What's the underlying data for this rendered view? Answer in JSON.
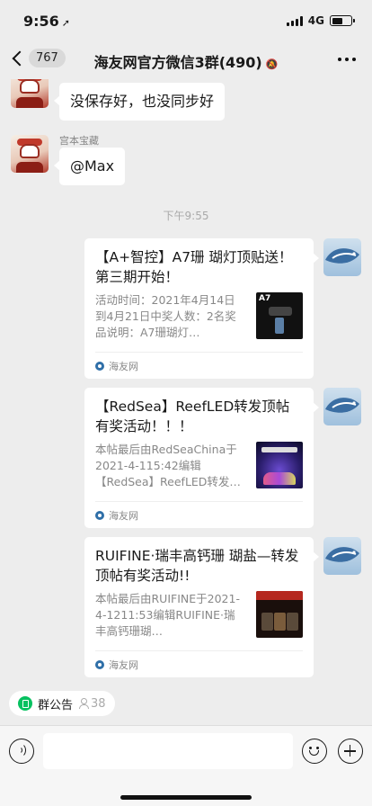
{
  "status_bar": {
    "time": "9:56",
    "network": "4G"
  },
  "nav": {
    "back_badge": "767",
    "title": "海友网官方微信3群(490)"
  },
  "messages": [
    {
      "text": "没保存好，也没同步好"
    },
    {
      "sender": "宫本宝藏",
      "text": "@Max"
    }
  ],
  "time_separator": "下午9:55",
  "cards": [
    {
      "title": "【A+智控】A7珊 瑚灯顶贴送！第三期开始！",
      "desc": "活动时间：2021年4月14日到4月21日中奖人数：2名奖品说明：A7珊瑚灯…",
      "thumb_label": "A7",
      "source": "海友网"
    },
    {
      "title": "【RedSea】ReefLED转发顶帖有奖活动！！！",
      "desc": "本帖最后由RedSeaChina于2021-4-115:42编辑【RedSea】ReefLED转发…",
      "source": "海友网"
    },
    {
      "title": "RUIFINE·瑞丰高钙珊 瑚盐—转发顶帖有奖活动!!",
      "desc": "本帖最后由RUIFINE于2021-4-1211:53编辑RUIFINE·瑞丰高钙珊瑚…",
      "source": "海友网"
    }
  ],
  "notice": {
    "label": "群公告",
    "count": "38"
  },
  "colors": {
    "accent_green": "#07c160",
    "chat_bg": "#ededed",
    "bubble": "#ffffff"
  },
  "icons": [
    "location-arrow-icon",
    "signal-icon",
    "battery-icon",
    "back-chevron-icon",
    "mute-bell-icon",
    "more-dots-icon",
    "voice-icon",
    "emoji-icon",
    "plus-icon",
    "notice-icon",
    "person-icon",
    "source-icon"
  ]
}
